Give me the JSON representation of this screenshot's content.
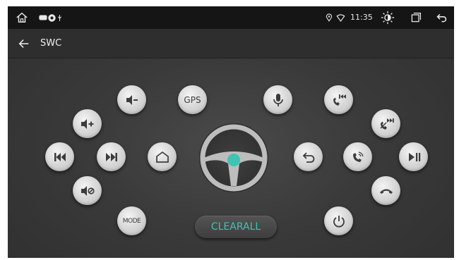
{
  "status_bar": {
    "time": "11:35",
    "icons": [
      "home-icon",
      "notification-icon",
      "record-icon",
      "usb-icon",
      "location-icon",
      "wifi-icon",
      "brightness-icon",
      "recent-apps-icon",
      "back-icon"
    ]
  },
  "titlebar": {
    "title": "SWC",
    "back_icon": "arrow-left-icon"
  },
  "buttons": {
    "gps_label": "GPS",
    "mode_label": "MODE",
    "clearall_label": "CLEARALL"
  },
  "colors": {
    "accent": "#3fc3b3",
    "button_face": "#d9d9d9",
    "icon": "#3c3c3c",
    "background": "#3a3a3a",
    "status_bar": "#151515"
  }
}
